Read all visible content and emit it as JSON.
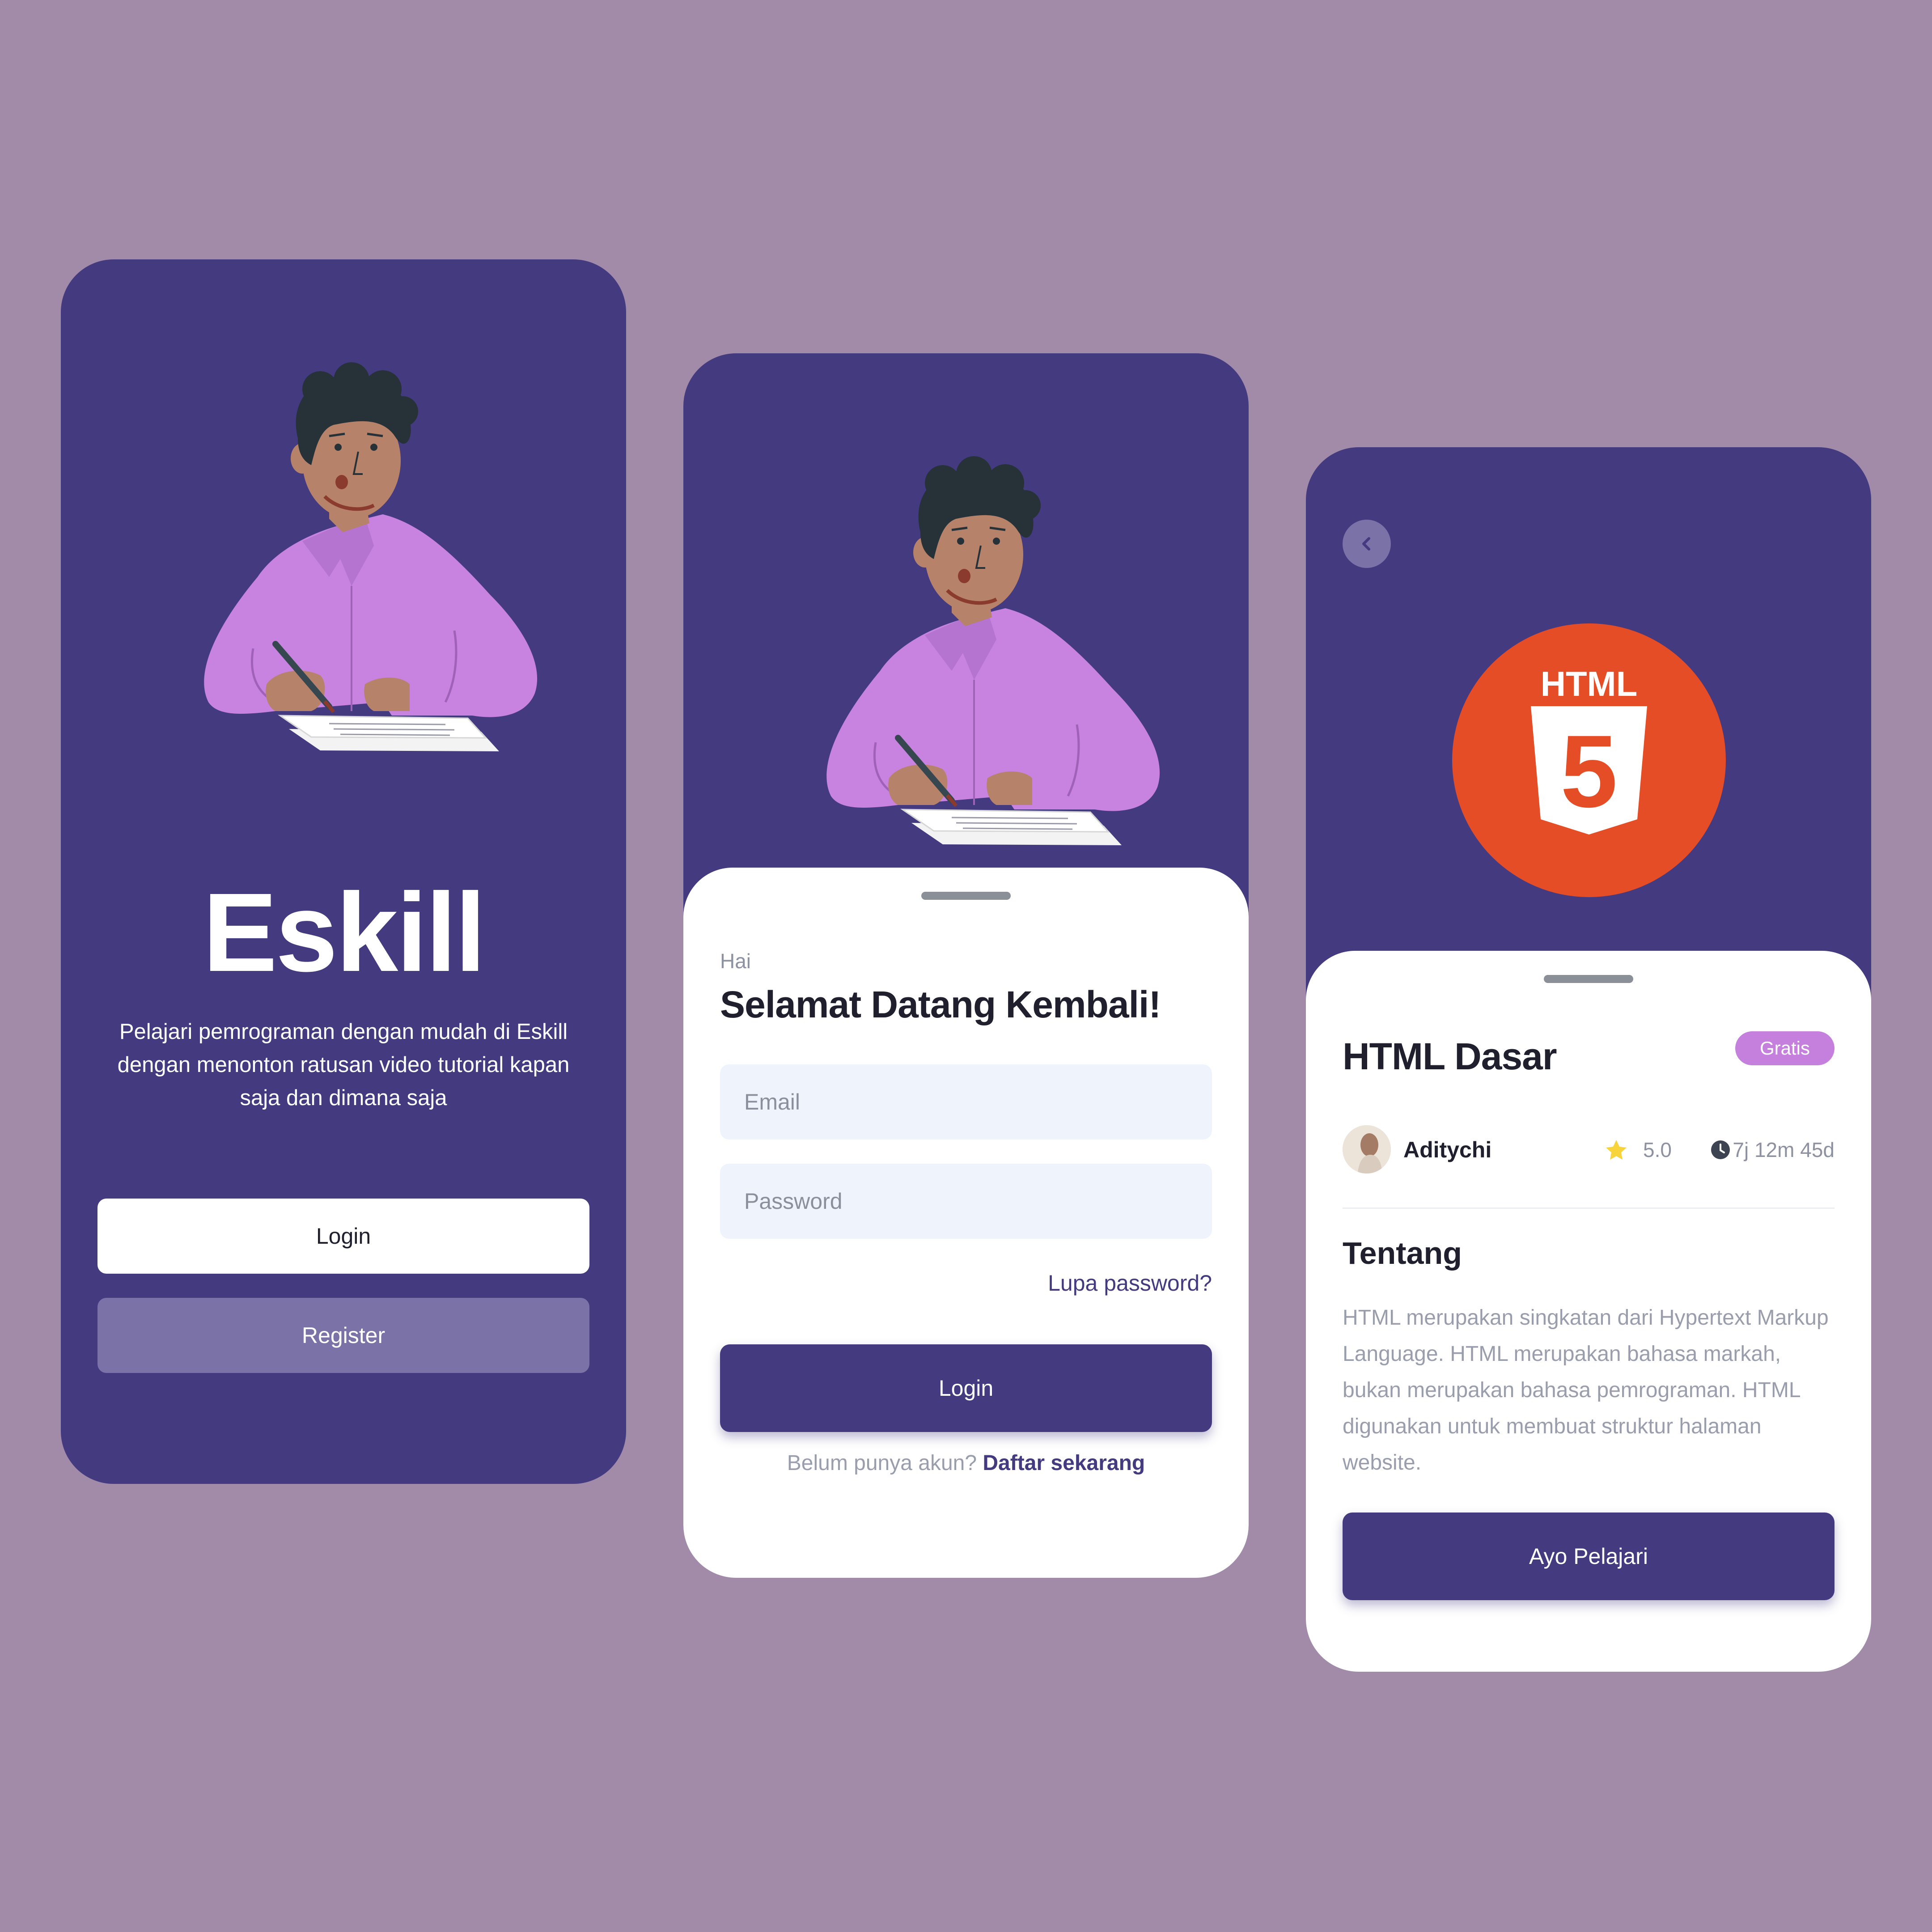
{
  "colors": {
    "background": "#a18ba8",
    "primary": "#433a80",
    "accent": "#c57fdc",
    "html_orange": "#e44d26",
    "field_bg": "#eff3fc"
  },
  "welcome_screen": {
    "app_name": "Eskill",
    "tagline": "Pelajari pemrograman dengan mudah di Eskill dengan menonton ratusan video tutorial kapan saja dan dimana saja",
    "login_label": "Login",
    "register_label": "Register",
    "illustration": "student-writing-illustration"
  },
  "login_screen": {
    "greeting": "Hai",
    "title": "Selamat Datang Kembali!",
    "email_placeholder": "Email",
    "password_placeholder": "Password",
    "forgot_label": "Lupa password?",
    "login_label": "Login",
    "no_account_text": "Belum punya akun?",
    "signup_link": "Daftar sekarang",
    "illustration": "student-writing-illustration"
  },
  "course_screen": {
    "back_icon": "chevron-left-icon",
    "logo_label": "HTML",
    "logo_number": "5",
    "title": "HTML Dasar",
    "badge": "Gratis",
    "author": "Aditychi",
    "rating": "5.0",
    "duration": "7j 12m 45d",
    "section_title": "Tentang",
    "about": "HTML merupakan singkatan dari Hypertext Markup Language. HTML merupakan bahasa markah, bukan merupakan bahasa pemrograman. HTML digunakan untuk membuat struktur halaman website.",
    "cta_label": "Ayo Pelajari"
  }
}
